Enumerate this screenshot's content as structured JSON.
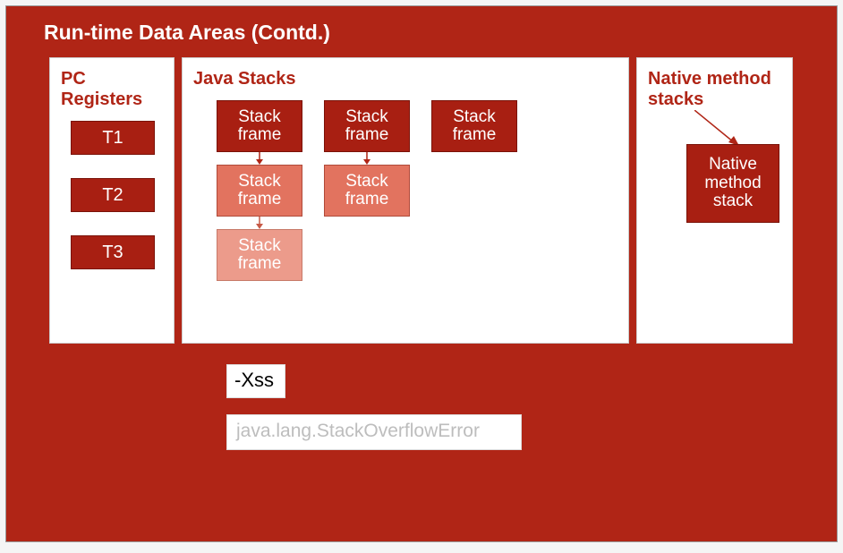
{
  "slide": {
    "title": "Run-time Data Areas (Contd.)"
  },
  "pc_registers": {
    "title": "PC Registers",
    "threads": [
      "T1",
      "T2",
      "T3"
    ]
  },
  "java_stacks": {
    "title": "Java Stacks",
    "columns": [
      {
        "frames": [
          "Stack frame",
          "Stack frame",
          "Stack frame"
        ]
      },
      {
        "frames": [
          "Stack frame",
          "Stack frame"
        ]
      },
      {
        "frames": [
          "Stack frame"
        ]
      }
    ]
  },
  "native_stacks": {
    "title": "Native method stacks",
    "box": "Native method stack"
  },
  "footer": {
    "xss": "-Xss",
    "error": "java.lang.StackOverflowError"
  },
  "colors": {
    "slide_bg": "#b02516",
    "box_bg": "#a81f12"
  }
}
